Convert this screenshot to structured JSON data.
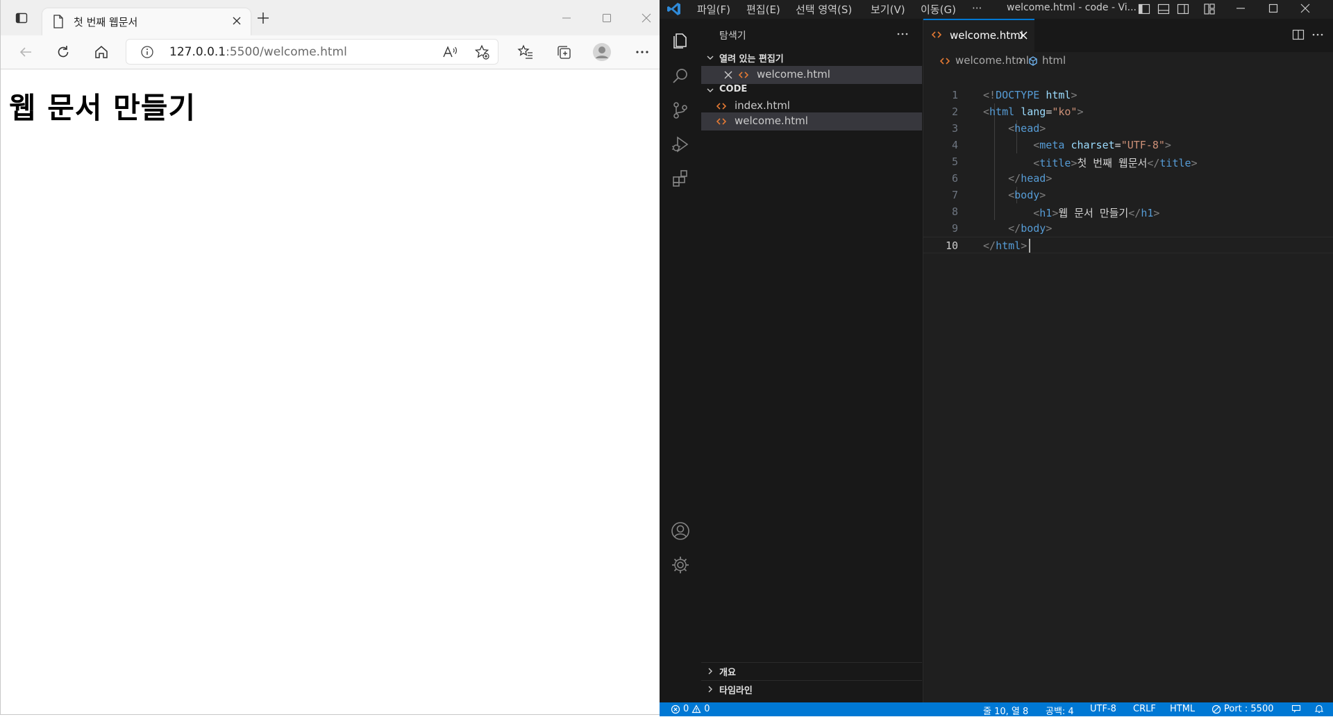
{
  "browser": {
    "tab_title": "첫 번째 웹문서",
    "url_host": "127.0.0.1",
    "url_rest": ":5500/welcome.html",
    "page_heading": "웹 문서 만들기"
  },
  "vscode": {
    "menu": [
      "파일(F)",
      "편집(E)",
      "선택 영역(S)",
      "보기(V)",
      "이동(G)",
      "···"
    ],
    "window_title": "welcome.html - code - Vi...",
    "sidebar": {
      "title": "탐색기",
      "open_editors_header": "열려 있는 편집기",
      "open_editors": [
        "welcome.html"
      ],
      "folder_header": "CODE",
      "files": [
        "index.html",
        "welcome.html"
      ],
      "outline_header": "개요",
      "timeline_header": "타임라인"
    },
    "editor": {
      "tab_label": "welcome.html",
      "breadcrumb": [
        "welcome.html",
        "html"
      ],
      "line_numbers": [
        "1",
        "2",
        "3",
        "4",
        "5",
        "6",
        "7",
        "8",
        "9",
        "10"
      ],
      "code": {
        "l1_open": "<!",
        "l1_doctype": "DOCTYPE",
        "l1_html": "html",
        "l1_close": ">",
        "l2_tag": "html",
        "l2_attr": "lang",
        "l2_val": "\"ko\"",
        "l3_tag": "head",
        "l4_tag": "meta",
        "l4_attr": "charset",
        "l4_val": "\"UTF-8\"",
        "l5_tag": "title",
        "l5_text": "첫 번째 웹문서",
        "l6_tag": "head",
        "l7_tag": "body",
        "l8_tag": "h1",
        "l8_text": "웹 문서 만들기",
        "l9_tag": "body",
        "l10_tag": "html"
      }
    },
    "status": {
      "errors": "0",
      "warnings": "0",
      "position": "줄 10, 열 8",
      "spaces": "공백: 4",
      "encoding": "UTF-8",
      "eol": "CRLF",
      "language": "HTML",
      "port": "Port : 5500"
    }
  },
  "colors": {
    "vscode_accent": "#0078d4",
    "html_tag": "#569cd6",
    "html_attr": "#9cdcfe",
    "html_string": "#ce9178",
    "file_icon": "#e37933"
  }
}
